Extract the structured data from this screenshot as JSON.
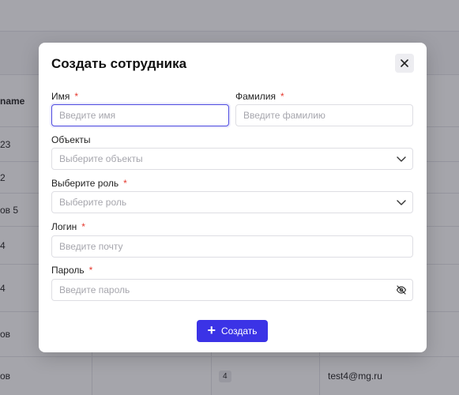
{
  "background": {
    "table": {
      "header_fragment": "name",
      "rows": [
        {
          "col1": "23",
          "col3": "",
          "col4": ""
        },
        {
          "col1": "2",
          "col3": "",
          "col4": ""
        },
        {
          "col1": "ов 5",
          "col3": "",
          "col4": ""
        },
        {
          "col1": "4",
          "col3": "",
          "col4": ""
        },
        {
          "col1": "4",
          "col3": "",
          "col4": ""
        },
        {
          "col1": "ов",
          "col3": "",
          "col4": ""
        },
        {
          "col1": "ов",
          "col3": "4",
          "col4": "test4@mg.ru"
        }
      ]
    }
  },
  "modal": {
    "title": "Создать сотрудника",
    "close_icon": "close-icon",
    "fields": {
      "first_name": {
        "label": "Имя",
        "required_mark": "*",
        "value": "",
        "placeholder": "Введите имя"
      },
      "last_name": {
        "label": "Фамилия",
        "required_mark": "*",
        "value": "",
        "placeholder": "Введите фамилию"
      },
      "objects": {
        "label": "Объекты",
        "placeholder": "Выберите объекты"
      },
      "role": {
        "label": "Выберите роль",
        "required_mark": "*",
        "placeholder": "Выберите роль"
      },
      "login": {
        "label": "Логин",
        "required_mark": "*",
        "value": "",
        "placeholder": "Введите почту"
      },
      "password": {
        "label": "Пароль",
        "required_mark": "*",
        "value": "",
        "placeholder": "Введите пароль"
      }
    },
    "submit_label": "Создать"
  },
  "colors": {
    "accent": "#3b33e6",
    "focus_border": "#4f4ce0",
    "required": "#e5382d"
  }
}
